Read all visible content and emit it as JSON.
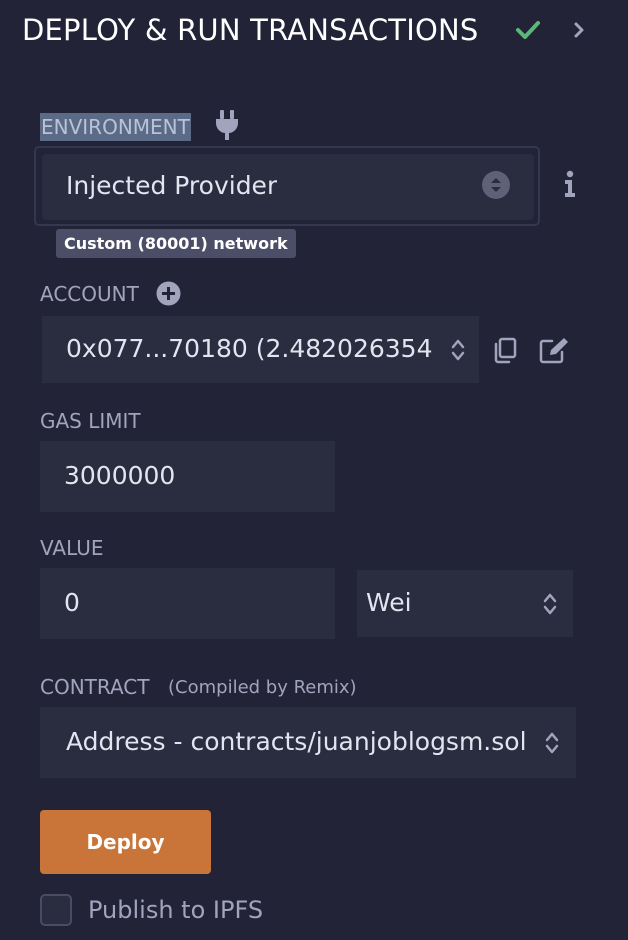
{
  "header": {
    "title": "DEPLOY & RUN TRANSACTIONS",
    "check_icon": "check-icon",
    "chevron_icon": "chevron-right-icon",
    "check_color": "#5cb67a"
  },
  "environment": {
    "label": "ENVIRONMENT",
    "icon": "plug-icon",
    "selected": "Injected Provider",
    "network_badge": "Custom (80001) network",
    "info_icon": "info-icon"
  },
  "account": {
    "label": "ACCOUNT",
    "add_icon": "plus-circle-icon",
    "selected": "0x077...70180 (2.482026354",
    "copy_icon": "copy-icon",
    "edit_icon": "edit-icon"
  },
  "gas_limit": {
    "label": "GAS LIMIT",
    "value": "3000000"
  },
  "value": {
    "label": "VALUE",
    "amount": "0",
    "unit": "Wei"
  },
  "contract": {
    "label": "CONTRACT",
    "sublabel": "(Compiled by Remix)",
    "selected": "Address - contracts/juanjoblogsm.sol"
  },
  "deploy": {
    "label": "Deploy",
    "color": "#c97539"
  },
  "publish": {
    "label": "Publish to IPFS",
    "checked": false
  }
}
